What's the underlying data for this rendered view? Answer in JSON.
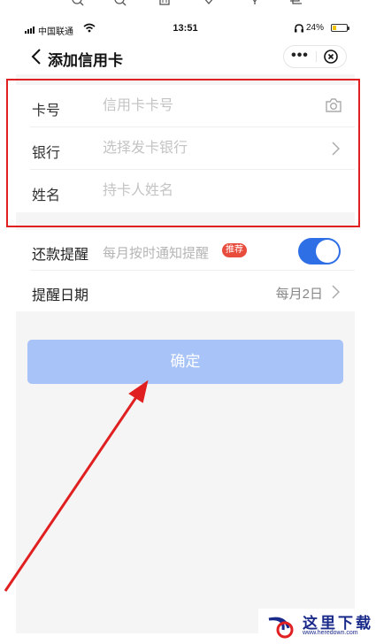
{
  "status_bar": {
    "carrier": "中国联通",
    "time": "13:51",
    "battery": "24%",
    "battery_level_fraction": 0.24
  },
  "nav": {
    "title": "添加信用卡",
    "more_label": "•••"
  },
  "form": {
    "card_number": {
      "label": "卡号",
      "placeholder": "信用卡卡号",
      "value": ""
    },
    "bank": {
      "label": "银行",
      "placeholder": "选择发卡银行",
      "value": ""
    },
    "name": {
      "label": "姓名",
      "placeholder": "持卡人姓名",
      "value": ""
    }
  },
  "reminder": {
    "label": "还款提醒",
    "hint": "每月按时通知提醒",
    "badge": "推荐",
    "enabled": true
  },
  "reminder_date": {
    "label": "提醒日期",
    "value": "每月2日"
  },
  "confirm_label": "确定",
  "colors": {
    "accent_blue": "#2f6fe6",
    "disabled_button": "#a8c3f8",
    "badge_red": "#e84c3d",
    "annotation_red": "#e02020"
  },
  "icons": [
    "search-icon",
    "zoom-icon",
    "trash-icon",
    "heart-icon",
    "share-icon",
    "crop-icon",
    "back-icon",
    "more-icon",
    "close-icon",
    "camera-icon",
    "chevron-right-icon"
  ],
  "watermark": {
    "text": "这里下载",
    "url": "www.heredown.com"
  }
}
